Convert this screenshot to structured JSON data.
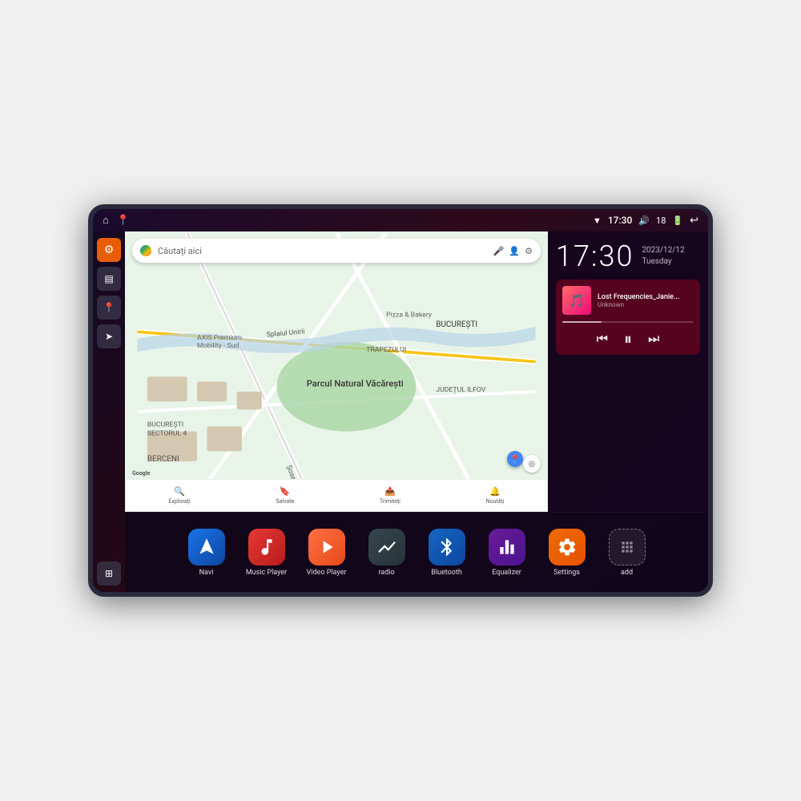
{
  "device": {
    "status_bar": {
      "left_icons": [
        "home",
        "map-pin"
      ],
      "time": "17:30",
      "icons_right": [
        "wifi",
        "volume",
        "18",
        "battery",
        "back"
      ]
    },
    "clock": {
      "time": "17:30",
      "date": "2023/12/12",
      "day": "Tuesday"
    },
    "music": {
      "title": "Lost Frequencies_Janie...",
      "artist": "Unknown",
      "progress": 30
    },
    "map": {
      "search_placeholder": "Căutați aici",
      "places": [
        "Parcul Natural Văcărești",
        "AXIS Premium Mobility - Sud",
        "Pizza & Bakery",
        "BUCUREȘTI",
        "JUDEȚUL ILFOV",
        "BERCENI",
        "BUCUREȘTI SECTORUL 4"
      ],
      "nav_items": [
        {
          "icon": "🔍",
          "label": "Explorați"
        },
        {
          "icon": "🔖",
          "label": "Salvate"
        },
        {
          "icon": "📤",
          "label": "Trimiteți"
        },
        {
          "icon": "🔔",
          "label": "Noutăți"
        }
      ]
    },
    "sidebar": {
      "items": [
        {
          "icon": "⚙",
          "style": "orange"
        },
        {
          "icon": "🗂",
          "style": "dark"
        },
        {
          "icon": "📍",
          "style": "dark"
        },
        {
          "icon": "➤",
          "style": "dark"
        },
        {
          "icon": "⋯",
          "style": "dark",
          "bottom": true
        }
      ]
    },
    "apps": [
      {
        "id": "navi",
        "label": "Navi",
        "icon": "➤",
        "bg": "bg-blue"
      },
      {
        "id": "music-player",
        "label": "Music Player",
        "icon": "♪",
        "bg": "bg-red"
      },
      {
        "id": "video-player",
        "label": "Video Player",
        "icon": "▶",
        "bg": "bg-orange-vid"
      },
      {
        "id": "radio",
        "label": "radio",
        "icon": "📶",
        "bg": "bg-dark-radio"
      },
      {
        "id": "bluetooth",
        "label": "Bluetooth",
        "icon": "⚡",
        "bg": "bg-blue-bt"
      },
      {
        "id": "equalizer",
        "label": "Equalizer",
        "icon": "🎛",
        "bg": "bg-purple-eq"
      },
      {
        "id": "settings",
        "label": "Settings",
        "icon": "⚙",
        "bg": "bg-orange-set"
      },
      {
        "id": "add",
        "label": "add",
        "icon": "+",
        "bg": "bg-grid-add"
      }
    ],
    "controls": {
      "prev": "⏮",
      "pause": "⏸",
      "next": "⏭"
    }
  }
}
